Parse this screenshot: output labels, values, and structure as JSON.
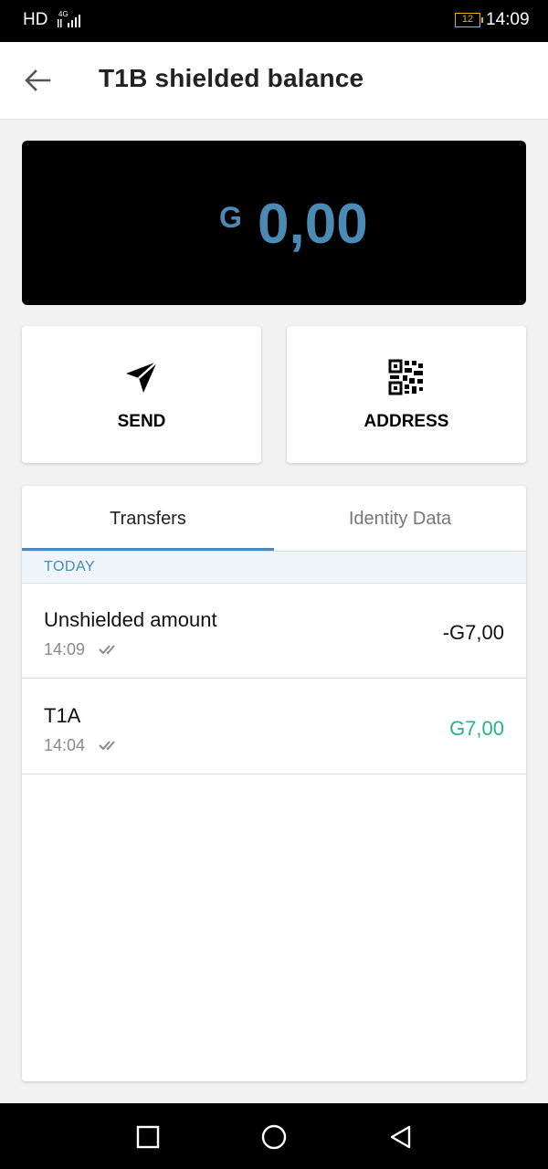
{
  "status_bar": {
    "left_label": "HD",
    "network": "4G",
    "battery": "12",
    "time": "14:09"
  },
  "app_bar": {
    "title": "T1B shielded balance",
    "back_icon": "arrow-left-icon"
  },
  "balance": {
    "symbol": "G",
    "amount": "0,00",
    "color": "#4a8ab5"
  },
  "actions": [
    {
      "label": "SEND",
      "icon": "send-icon"
    },
    {
      "label": "ADDRESS",
      "icon": "qr-code-icon"
    }
  ],
  "tabs": [
    {
      "label": "Transfers",
      "active": true
    },
    {
      "label": "Identity Data",
      "active": false
    }
  ],
  "section_header": "TODAY",
  "transactions": [
    {
      "name": "Unshielded amount",
      "time": "14:09",
      "amount": "-G7,00",
      "status": "double-check-icon"
    },
    {
      "name": "T1A",
      "time": "14:04",
      "amount": "G7,00",
      "status": "double-check-icon",
      "amount_color": "#27b38a"
    }
  ],
  "nav_bar": [
    "square-icon",
    "circle-icon",
    "triangle-back-icon"
  ]
}
